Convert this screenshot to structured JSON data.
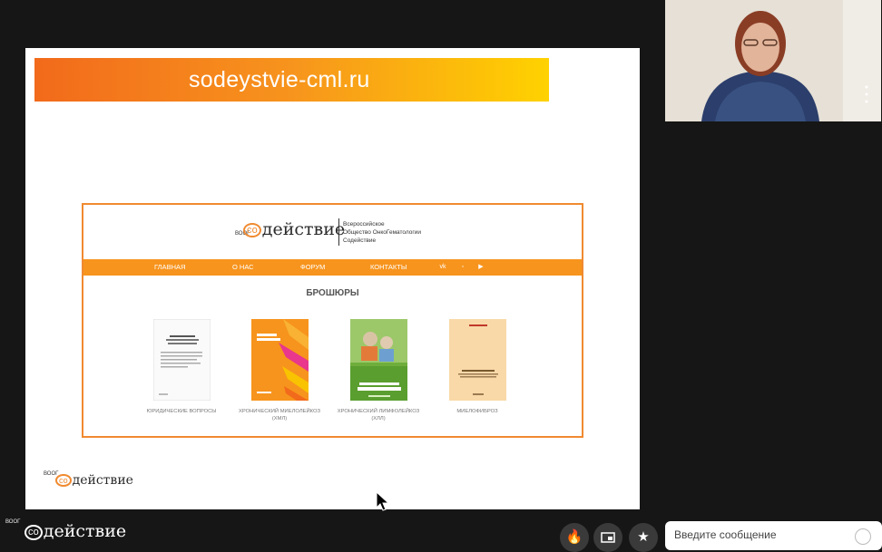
{
  "slide": {
    "banner_text": "sodeystvie-cml.ru",
    "site": {
      "logo_prefix": "ВООГ",
      "logo_co": "со",
      "logo_word": "действие",
      "subtitle_lines": [
        "Всероссийское",
        "Общество ОнкоГематологии",
        "Содействие"
      ],
      "nav": [
        "ГЛАВНАЯ",
        "О НАС",
        "ФОРУМ",
        "КОНТАКТЫ"
      ],
      "section_title": "БРОШЮРЫ",
      "brochures": [
        {
          "caption_lines": [
            "ЮРИДИЧЕСКИЕ ВОПРОСЫ"
          ]
        },
        {
          "caption_lines": [
            "ХРОНИЧЕСКИЙ МИЕЛОЛЕЙКОЗ",
            "(ХМЛ)"
          ],
          "cover_text": "ЗНАТЬ, ЧТОБЫ ЖИТЬ"
        },
        {
          "caption_lines": [
            "ХРОНИЧЕСКИЙ ЛИМФОЛЕЙКОЗ",
            "(ХЛЛ)"
          ],
          "cover_text": "РУКОВОДСТВО ДЛЯ ПАЦИЕНТА"
        },
        {
          "caption_lines": [
            "МИЕЛОФИБРОЗ"
          ]
        }
      ]
    },
    "footer_logo": {
      "prefix": "ВООГ",
      "co": "со",
      "word": "действие"
    }
  },
  "app": {
    "logo": {
      "prefix": "ВООГ",
      "co": "со",
      "word": "действие"
    },
    "controls": [
      {
        "name": "reaction",
        "icon": "fire-icon"
      },
      {
        "name": "pip",
        "icon": "picture-in-picture-icon"
      },
      {
        "name": "favorite",
        "icon": "star-icon"
      }
    ],
    "message_placeholder": "Введите сообщение"
  }
}
